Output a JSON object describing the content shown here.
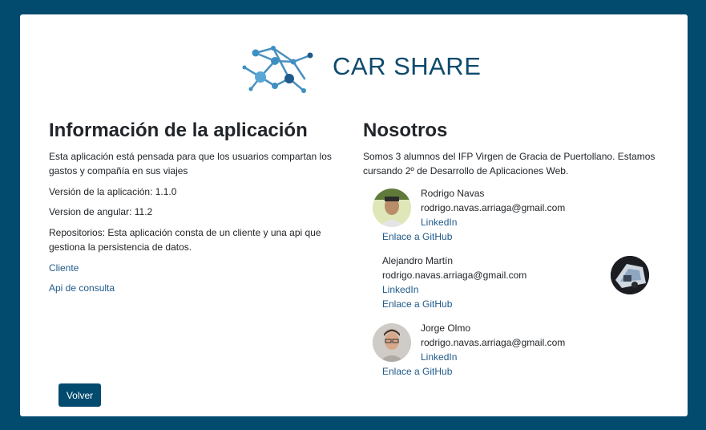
{
  "brand": {
    "name": "CAR SHARE"
  },
  "info": {
    "heading": "Información de la aplicación",
    "description": "Esta aplicación está pensada para que los usuarios compartan los gastos y compañía en sus viajes",
    "version_app": "Versión de la aplicación: 1.1.0",
    "version_angular": "Version de angular: 11.2",
    "repos": "Repositorios: Esta aplicación consta de un cliente y una api que gestiona la persistencia de datos.",
    "link_client": "Cliente",
    "link_api": "Api de consulta"
  },
  "team": {
    "heading": "Nosotros",
    "intro": "Somos 3 alumnos del IFP Virgen de Gracia de Puertollano. Estamos cursando 2º de Desarrollo de Aplicaciones Web.",
    "members": [
      {
        "name": "Rodrigo Navas",
        "email": "rodrigo.navas.arriaga@gmail.com",
        "linkedin": "LinkedIn",
        "github": "Enlace a GitHub"
      },
      {
        "name": "Alejandro Martín",
        "email": "rodrigo.navas.arriaga@gmail.com",
        "linkedin": "LinkedIn",
        "github": "Enlace a GitHub"
      },
      {
        "name": "Jorge Olmo",
        "email": "rodrigo.navas.arriaga@gmail.com",
        "linkedin": "LinkedIn",
        "github": "Enlace a GitHub"
      }
    ]
  },
  "actions": {
    "back": "Volver"
  },
  "colors": {
    "background": "#024a6e",
    "brand": "#0c4a6e",
    "link": "#1f5a8a",
    "button": "#024a6e"
  }
}
